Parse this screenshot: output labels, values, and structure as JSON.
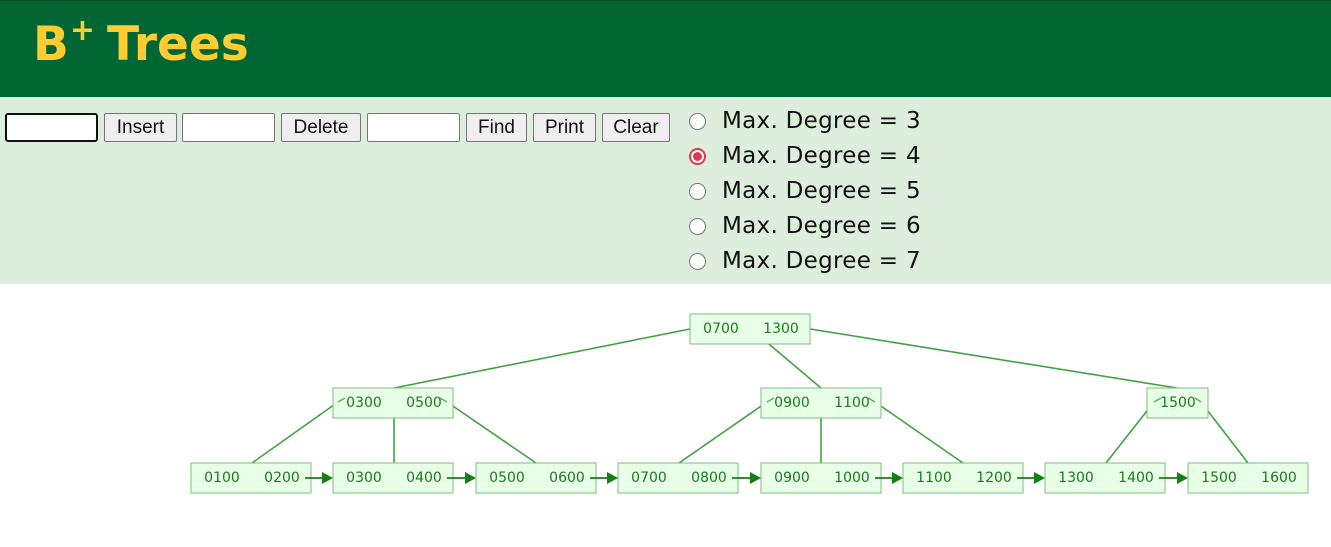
{
  "header": {
    "title_b": "B",
    "title_sup": "+",
    "title_rest": "Trees"
  },
  "controls": {
    "insert_value": "",
    "insert_label": "Insert",
    "delete_value": "",
    "delete_label": "Delete",
    "find_value": "",
    "find_label": "Find",
    "print_label": "Print",
    "clear_label": "Clear"
  },
  "degree_options": [
    {
      "label": "Max. Degree = 3",
      "checked": false
    },
    {
      "label": "Max. Degree = 4",
      "checked": true
    },
    {
      "label": "Max. Degree = 5",
      "checked": false
    },
    {
      "label": "Max. Degree = 6",
      "checked": false
    },
    {
      "label": "Max. Degree = 7",
      "checked": false
    }
  ],
  "tree": {
    "root": [
      "0700",
      "1300"
    ],
    "internal": [
      [
        "0300",
        "0500"
      ],
      [
        "0900",
        "1100"
      ],
      [
        "1500"
      ]
    ],
    "leaves": [
      [
        "0100",
        "0200"
      ],
      [
        "0300",
        "0400"
      ],
      [
        "0500",
        "0600"
      ],
      [
        "0700",
        "0800"
      ],
      [
        "0900",
        "1000"
      ],
      [
        "1100",
        "1200"
      ],
      [
        "1300",
        "1400"
      ],
      [
        "1500",
        "1600"
      ]
    ]
  },
  "colors": {
    "header_bg": "#006633",
    "title": "#FFCC33",
    "controls_bg": "#DDEEDD",
    "node_fill": "#E8FFE8",
    "node_stroke": "#7BBF7B",
    "edge": "#44A044",
    "pointer": "#138013",
    "radio_checked": "#E0384F"
  }
}
